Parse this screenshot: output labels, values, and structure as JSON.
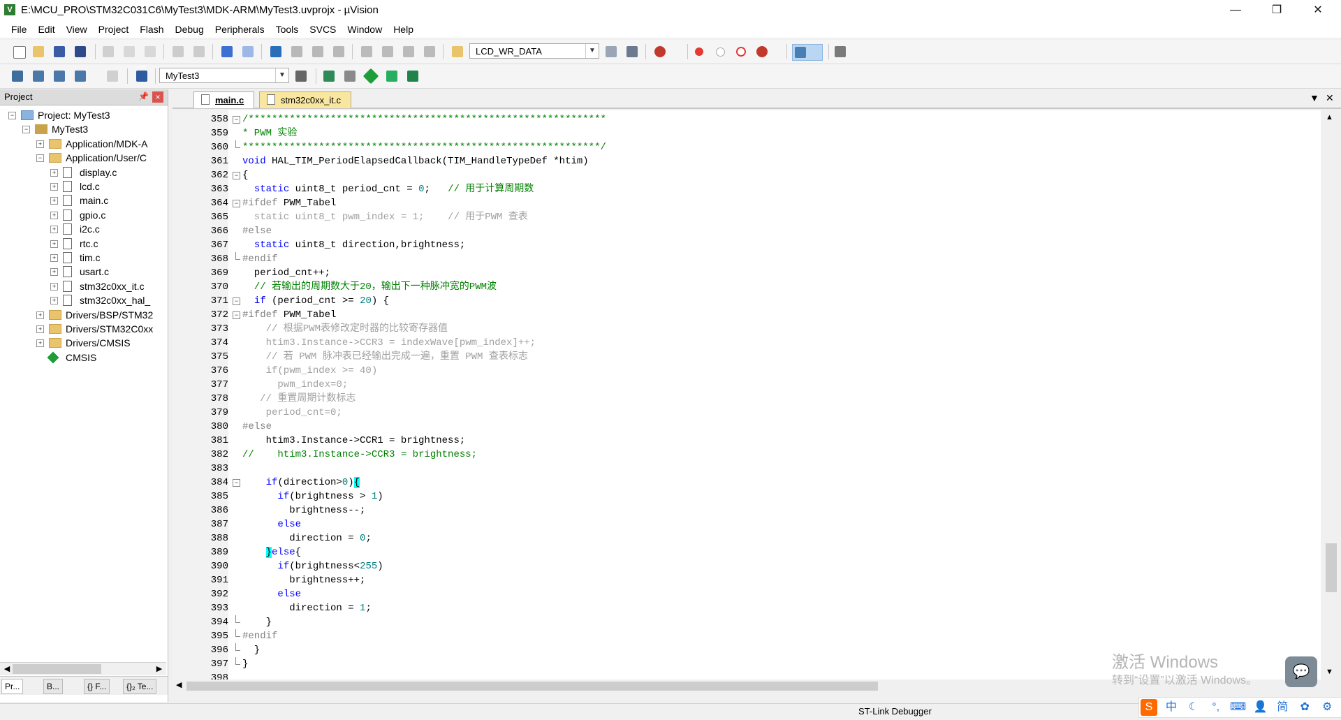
{
  "window": {
    "title": "E:\\MCU_PRO\\STM32C031C6\\MyTest3\\MDK-ARM\\MyTest3.uvprojx - µVision",
    "icon_name": "uvision-app-icon",
    "controls": [
      "minimize-icon",
      "restore-icon",
      "close-icon"
    ]
  },
  "menu": [
    "File",
    "Edit",
    "View",
    "Project",
    "Flash",
    "Debug",
    "Peripherals",
    "Tools",
    "SVCS",
    "Window",
    "Help"
  ],
  "toolbar1": {
    "find_combo_value": "LCD_WR_DATA",
    "icons": [
      "new-file-icon",
      "open-file-icon",
      "save-icon",
      "save-all-icon",
      "cut-icon",
      "copy-icon",
      "paste-icon",
      "undo-icon",
      "redo-icon",
      "navigate-back-icon",
      "navigate-forward-icon",
      "bookmark-icon",
      "prev-bookmark-icon",
      "next-bookmark-icon",
      "clear-bookmarks-icon",
      "indent-icon",
      "unindent-icon",
      "comment-icon",
      "uncomment-icon",
      "find-in-files-icon",
      "find-icon",
      "incremental-find-icon",
      "debug-session-icon",
      "breakpoint-icon",
      "disable-breakpoint-icon",
      "kill-breakpoints-icon",
      "disable-all-breakpoints-icon",
      "window-layout-icon",
      "configure-icon"
    ]
  },
  "toolbar2": {
    "target_combo_value": "MyTest3",
    "icons": [
      "translate-icon",
      "build-icon",
      "rebuild-icon",
      "batch-build-icon",
      "stop-build-icon",
      "download-icon",
      "target-options-icon",
      "manage-components-icon",
      "select-packs-icon",
      "pack-installer-icon",
      "event-recorder-icon"
    ],
    "load_label": "LOAD"
  },
  "project_panel": {
    "header": "Project",
    "tree": [
      {
        "label": "Project: MyTest3",
        "level": 0,
        "kind": "project",
        "expanded": true
      },
      {
        "label": "MyTest3",
        "level": 1,
        "kind": "target",
        "expanded": true
      },
      {
        "label": "Application/MDK-A",
        "level": 2,
        "kind": "folder",
        "expanded": false
      },
      {
        "label": "Application/User/C",
        "level": 2,
        "kind": "folder",
        "expanded": true
      },
      {
        "label": "display.c",
        "level": 3,
        "kind": "file"
      },
      {
        "label": "lcd.c",
        "level": 3,
        "kind": "file"
      },
      {
        "label": "main.c",
        "level": 3,
        "kind": "file"
      },
      {
        "label": "gpio.c",
        "level": 3,
        "kind": "file"
      },
      {
        "label": "i2c.c",
        "level": 3,
        "kind": "file"
      },
      {
        "label": "rtc.c",
        "level": 3,
        "kind": "file"
      },
      {
        "label": "tim.c",
        "level": 3,
        "kind": "file"
      },
      {
        "label": "usart.c",
        "level": 3,
        "kind": "file"
      },
      {
        "label": "stm32c0xx_it.c",
        "level": 3,
        "kind": "file"
      },
      {
        "label": "stm32c0xx_hal_",
        "level": 3,
        "kind": "file"
      },
      {
        "label": "Drivers/BSP/STM32",
        "level": 2,
        "kind": "folder",
        "expanded": false
      },
      {
        "label": "Drivers/STM32C0xx",
        "level": 2,
        "kind": "folder",
        "expanded": false
      },
      {
        "label": "Drivers/CMSIS",
        "level": 2,
        "kind": "folder",
        "expanded": false
      },
      {
        "label": "CMSIS",
        "level": 2,
        "kind": "component"
      }
    ],
    "bottom_tabs": [
      "Pr...",
      "B...",
      "{} F...",
      "{}₂ Te..."
    ]
  },
  "editor": {
    "tabs": [
      {
        "label": "main.c",
        "active": false
      },
      {
        "label": "stm32c0xx_it.c",
        "active": true
      }
    ],
    "lines": [
      {
        "n": "358",
        "fold": "minus",
        "parts": [
          {
            "t": "/*************************************************************",
            "c": "c-cm"
          }
        ]
      },
      {
        "n": "359",
        "fold": "",
        "parts": [
          {
            "t": "* PWM 实验",
            "c": "c-cm"
          }
        ]
      },
      {
        "n": "360",
        "fold": "end",
        "parts": [
          {
            "t": "*************************************************************/",
            "c": "c-cm"
          }
        ]
      },
      {
        "n": "361",
        "fold": "",
        "parts": [
          {
            "t": "void ",
            "c": "c-kw"
          },
          {
            "t": "HAL_TIM_PeriodElapsedCallback(TIM_HandleTypeDef *htim)",
            "c": ""
          }
        ]
      },
      {
        "n": "362",
        "fold": "minus",
        "parts": [
          {
            "t": "{",
            "c": ""
          }
        ]
      },
      {
        "n": "363",
        "fold": "",
        "parts": [
          {
            "t": "  ",
            "c": ""
          },
          {
            "t": "static ",
            "c": "c-kw"
          },
          {
            "t": "uint8_t period_cnt = ",
            "c": ""
          },
          {
            "t": "0",
            "c": "c-num"
          },
          {
            "t": ";   ",
            "c": ""
          },
          {
            "t": "// 用于计算周期数",
            "c": "c-cm"
          }
        ]
      },
      {
        "n": "364",
        "fold": "minus",
        "parts": [
          {
            "t": "#ifdef ",
            "c": "c-pp"
          },
          {
            "t": "PWM_Tabel",
            "c": ""
          }
        ]
      },
      {
        "n": "365",
        "fold": "",
        "parts": [
          {
            "t": "  static uint8_t pwm_index = 1;    // 用于PWM 查表",
            "c": "c-grey"
          }
        ]
      },
      {
        "n": "366",
        "fold": "",
        "parts": [
          {
            "t": "#else",
            "c": "c-pp"
          }
        ]
      },
      {
        "n": "367",
        "fold": "",
        "parts": [
          {
            "t": "  ",
            "c": ""
          },
          {
            "t": "static ",
            "c": "c-kw"
          },
          {
            "t": "uint8_t direction,brightness;",
            "c": ""
          }
        ]
      },
      {
        "n": "368",
        "fold": "end",
        "parts": [
          {
            "t": "#endif",
            "c": "c-pp"
          }
        ]
      },
      {
        "n": "369",
        "fold": "",
        "parts": [
          {
            "t": "  period_cnt++;",
            "c": ""
          }
        ]
      },
      {
        "n": "370",
        "fold": "",
        "parts": [
          {
            "t": "  // 若输出的周期数大于20，输出下一种脉冲宽的PWM波",
            "c": "c-cm"
          }
        ]
      },
      {
        "n": "371",
        "fold": "minus",
        "parts": [
          {
            "t": "  ",
            "c": ""
          },
          {
            "t": "if ",
            "c": "c-kw"
          },
          {
            "t": "(period_cnt >= ",
            "c": ""
          },
          {
            "t": "20",
            "c": "c-num"
          },
          {
            "t": ") {",
            "c": ""
          }
        ]
      },
      {
        "n": "372",
        "fold": "minus",
        "parts": [
          {
            "t": "#ifdef ",
            "c": "c-pp"
          },
          {
            "t": "PWM_Tabel",
            "c": ""
          }
        ]
      },
      {
        "n": "373",
        "fold": "",
        "parts": [
          {
            "t": "    // 根据PWM表修改定时器的比较寄存器值",
            "c": "c-grey"
          }
        ]
      },
      {
        "n": "374",
        "fold": "",
        "parts": [
          {
            "t": "    htim3.Instance->CCR3 = indexWave[pwm_index]++;",
            "c": "c-grey"
          }
        ]
      },
      {
        "n": "375",
        "fold": "",
        "parts": [
          {
            "t": "    // 若 PWM 脉冲表已经输出完成一遍，重置 PWM 查表标志",
            "c": "c-grey"
          }
        ]
      },
      {
        "n": "376",
        "fold": "",
        "parts": [
          {
            "t": "    if(pwm_index >= 40)",
            "c": "c-grey"
          }
        ]
      },
      {
        "n": "377",
        "fold": "",
        "parts": [
          {
            "t": "      pwm_index=0;",
            "c": "c-grey"
          }
        ]
      },
      {
        "n": "378",
        "fold": "",
        "parts": [
          {
            "t": "   // 重置周期计数标志",
            "c": "c-grey"
          }
        ]
      },
      {
        "n": "379",
        "fold": "",
        "parts": [
          {
            "t": "    period_cnt=0;",
            "c": "c-grey"
          }
        ]
      },
      {
        "n": "380",
        "fold": "",
        "parts": [
          {
            "t": "#else",
            "c": "c-pp"
          }
        ]
      },
      {
        "n": "381",
        "fold": "",
        "parts": [
          {
            "t": "    htim3.Instance->CCR1 = brightness;",
            "c": ""
          }
        ]
      },
      {
        "n": "382",
        "fold": "",
        "parts": [
          {
            "t": "//    htim3.Instance->CCR3 = brightness;",
            "c": "c-cm"
          }
        ]
      },
      {
        "n": "383",
        "fold": "",
        "parts": []
      },
      {
        "n": "384",
        "fold": "minus",
        "parts": [
          {
            "t": "    ",
            "c": ""
          },
          {
            "t": "if",
            "c": "c-kw"
          },
          {
            "t": "(direction>",
            "c": ""
          },
          {
            "t": "0",
            "c": "c-num"
          },
          {
            "t": ")",
            "c": ""
          },
          {
            "t": "{",
            "c": "c-match"
          }
        ]
      },
      {
        "n": "385",
        "fold": "",
        "parts": [
          {
            "t": "      ",
            "c": ""
          },
          {
            "t": "if",
            "c": "c-kw"
          },
          {
            "t": "(brightness > ",
            "c": ""
          },
          {
            "t": "1",
            "c": "c-num"
          },
          {
            "t": ")",
            "c": ""
          }
        ]
      },
      {
        "n": "386",
        "fold": "",
        "parts": [
          {
            "t": "        brightness--;",
            "c": ""
          }
        ]
      },
      {
        "n": "387",
        "fold": "",
        "parts": [
          {
            "t": "      ",
            "c": ""
          },
          {
            "t": "else",
            "c": "c-kw"
          }
        ]
      },
      {
        "n": "388",
        "fold": "",
        "parts": [
          {
            "t": "        direction = ",
            "c": ""
          },
          {
            "t": "0",
            "c": "c-num"
          },
          {
            "t": ";",
            "c": ""
          }
        ]
      },
      {
        "n": "389",
        "fold": "",
        "parts": [
          {
            "t": "    ",
            "c": ""
          },
          {
            "t": "}",
            "c": "c-match"
          },
          {
            "t": "else",
            "c": "c-kw"
          },
          {
            "t": "{",
            "c": ""
          }
        ]
      },
      {
        "n": "390",
        "fold": "",
        "parts": [
          {
            "t": "      ",
            "c": ""
          },
          {
            "t": "if",
            "c": "c-kw"
          },
          {
            "t": "(brightness<",
            "c": ""
          },
          {
            "t": "255",
            "c": "c-num"
          },
          {
            "t": ")",
            "c": ""
          }
        ]
      },
      {
        "n": "391",
        "fold": "",
        "parts": [
          {
            "t": "        brightness++;",
            "c": ""
          }
        ]
      },
      {
        "n": "392",
        "fold": "",
        "parts": [
          {
            "t": "      ",
            "c": ""
          },
          {
            "t": "else",
            "c": "c-kw"
          }
        ]
      },
      {
        "n": "393",
        "fold": "",
        "parts": [
          {
            "t": "        direction = ",
            "c": ""
          },
          {
            "t": "1",
            "c": "c-num"
          },
          {
            "t": ";",
            "c": ""
          }
        ]
      },
      {
        "n": "394",
        "fold": "end",
        "parts": [
          {
            "t": "    }",
            "c": ""
          }
        ]
      },
      {
        "n": "395",
        "fold": "end",
        "parts": [
          {
            "t": "#endif",
            "c": "c-pp"
          }
        ]
      },
      {
        "n": "396",
        "fold": "end",
        "parts": [
          {
            "t": "  }",
            "c": ""
          }
        ]
      },
      {
        "n": "397",
        "fold": "end",
        "parts": [
          {
            "t": "}",
            "c": ""
          }
        ]
      },
      {
        "n": "398",
        "fold": "",
        "parts": []
      }
    ]
  },
  "status": {
    "debugger": "ST-Link Debugger"
  },
  "watermark": {
    "line1": "激活 Windows",
    "line2": "转到“设置”以激活 Windows。"
  },
  "ime": [
    "中",
    "简"
  ],
  "colors": {
    "keyword": "#0000ff",
    "comment": "#008000",
    "preprocessor": "#808080",
    "number": "#008080",
    "inactive": "#a0a0a0",
    "active_tab": "#f9e79f",
    "brace_match": "#00ffff"
  }
}
